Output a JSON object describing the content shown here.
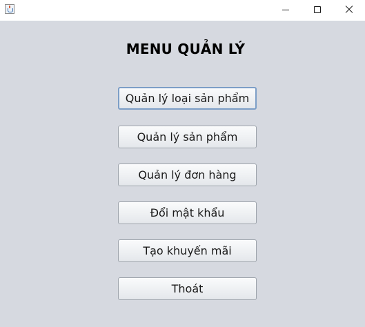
{
  "window": {
    "icon": "java-cup-icon",
    "controls": [
      "minimize-icon",
      "maximize-icon",
      "close-icon"
    ]
  },
  "main": {
    "title": "MENU QUẢN LÝ",
    "buttons": [
      {
        "label": "Quản lý loại sản phẩm",
        "focused": true
      },
      {
        "label": "Quản lý sản phẩm"
      },
      {
        "label": "Quản lý đơn hàng"
      },
      {
        "label": "Đổi mật khẩu"
      },
      {
        "label": "Tạo khuyến mãi"
      },
      {
        "label": "Thoát"
      }
    ]
  }
}
